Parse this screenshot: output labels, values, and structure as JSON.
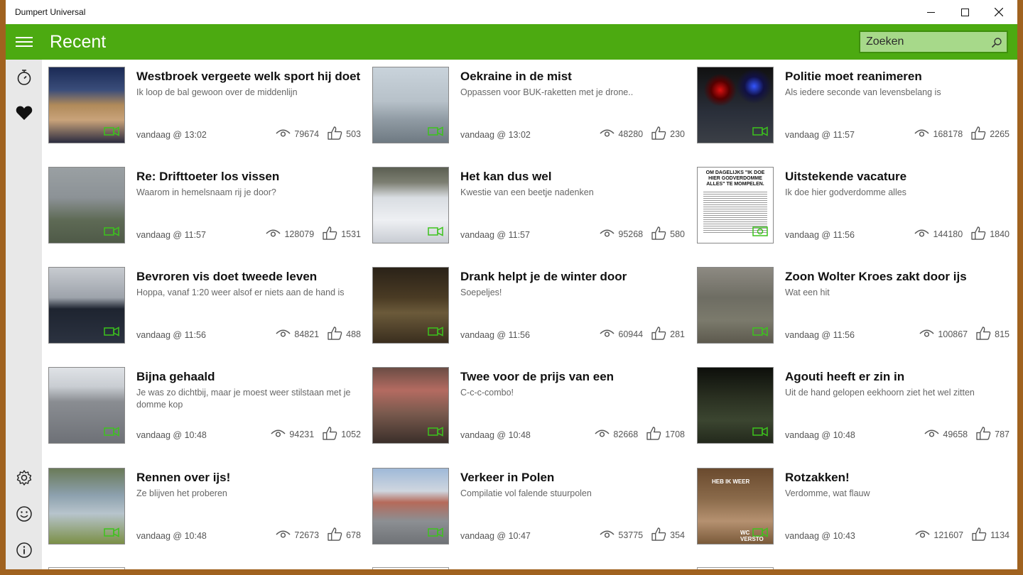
{
  "window": {
    "title": "Dumpert Universal"
  },
  "appbar": {
    "title": "Recent"
  },
  "search": {
    "placeholder": "Zoeken"
  },
  "sidebar": {
    "icons": [
      "timer-icon",
      "heart-icon",
      "gear-icon",
      "smiley-icon",
      "info-icon"
    ]
  },
  "colors": {
    "accent": "#4caa11",
    "frame": "#a0621f",
    "camera_icon": "#3cc31c"
  },
  "items": [
    {
      "title": "Westbroek vergeete welk sport hij doet",
      "subtitle": "Ik loop de bal gewoon over de middenlijn",
      "date": "vandaag @ 13:02",
      "views": "79674",
      "likes": "503",
      "media": "video"
    },
    {
      "title": "Oekraine in de mist",
      "subtitle": "Oppassen voor BUK-raketten met je drone..",
      "date": "vandaag @ 13:02",
      "views": "48280",
      "likes": "230",
      "media": "video"
    },
    {
      "title": "Politie moet reanimeren",
      "subtitle": "Als iedere seconde van levensbelang is",
      "date": "vandaag @ 11:57",
      "views": "168178",
      "likes": "2265",
      "media": "video"
    },
    {
      "title": "Re: Drifttoeter los vissen",
      "subtitle": "Waarom in hemelsnaam rij je door?",
      "date": "vandaag @ 11:57",
      "views": "128079",
      "likes": "1531",
      "media": "video"
    },
    {
      "title": "Het kan dus wel",
      "subtitle": "Kwestie van een beetje nadenken",
      "date": "vandaag @ 11:57",
      "views": "95268",
      "likes": "580",
      "media": "video"
    },
    {
      "title": "Uitstekende vacature",
      "subtitle": "Ik doe hier godverdomme alles",
      "date": "vandaag @ 11:56",
      "views": "144180",
      "likes": "1840",
      "media": "photo",
      "thumb_text": "OM DAGELIJKS \"IK DOE HIER GODVERDOMME ALLES\" TE MOMPELEN."
    },
    {
      "title": "Bevroren vis doet tweede leven",
      "subtitle": "Hoppa, vanaf 1:20 weer alsof er niets aan de hand is",
      "date": "vandaag @ 11:56",
      "views": "84821",
      "likes": "488",
      "media": "video"
    },
    {
      "title": "Drank helpt je de winter door",
      "subtitle": "Soepeljes!",
      "date": "vandaag @ 11:56",
      "views": "60944",
      "likes": "281",
      "media": "video"
    },
    {
      "title": "Zoon Wolter Kroes zakt door ijs",
      "subtitle": "Wat een hit",
      "date": "vandaag @ 11:56",
      "views": "100867",
      "likes": "815",
      "media": "video"
    },
    {
      "title": "Bijna gehaald",
      "subtitle": "Je was zo dichtbij, maar je moest weer stilstaan met je domme kop",
      "date": "vandaag @ 10:48",
      "views": "94231",
      "likes": "1052",
      "media": "video"
    },
    {
      "title": "Twee voor de prijs van een",
      "subtitle": "C-c-c-combo!",
      "date": "vandaag @ 10:48",
      "views": "82668",
      "likes": "1708",
      "media": "video"
    },
    {
      "title": "Agouti heeft er zin in",
      "subtitle": "Uit de hand gelopen eekhoorn ziet het wel zitten",
      "date": "vandaag @ 10:48",
      "views": "49658",
      "likes": "787",
      "media": "video"
    },
    {
      "title": "Rennen over ijs!",
      "subtitle": "Ze blijven het proberen",
      "date": "vandaag @ 10:48",
      "views": "72673",
      "likes": "678",
      "media": "video"
    },
    {
      "title": "Verkeer in Polen",
      "subtitle": "Compilatie vol falende stuurpolen",
      "date": "vandaag @ 10:47",
      "views": "53775",
      "likes": "354",
      "media": "video"
    },
    {
      "title": "Rotzakken!",
      "subtitle": "Verdomme, wat flauw",
      "date": "vandaag @ 10:43",
      "views": "121607",
      "likes": "1134",
      "media": "video",
      "thumb_text": "HEB IK WEER",
      "thumb_text_2": "WC VERSTO"
    }
  ]
}
